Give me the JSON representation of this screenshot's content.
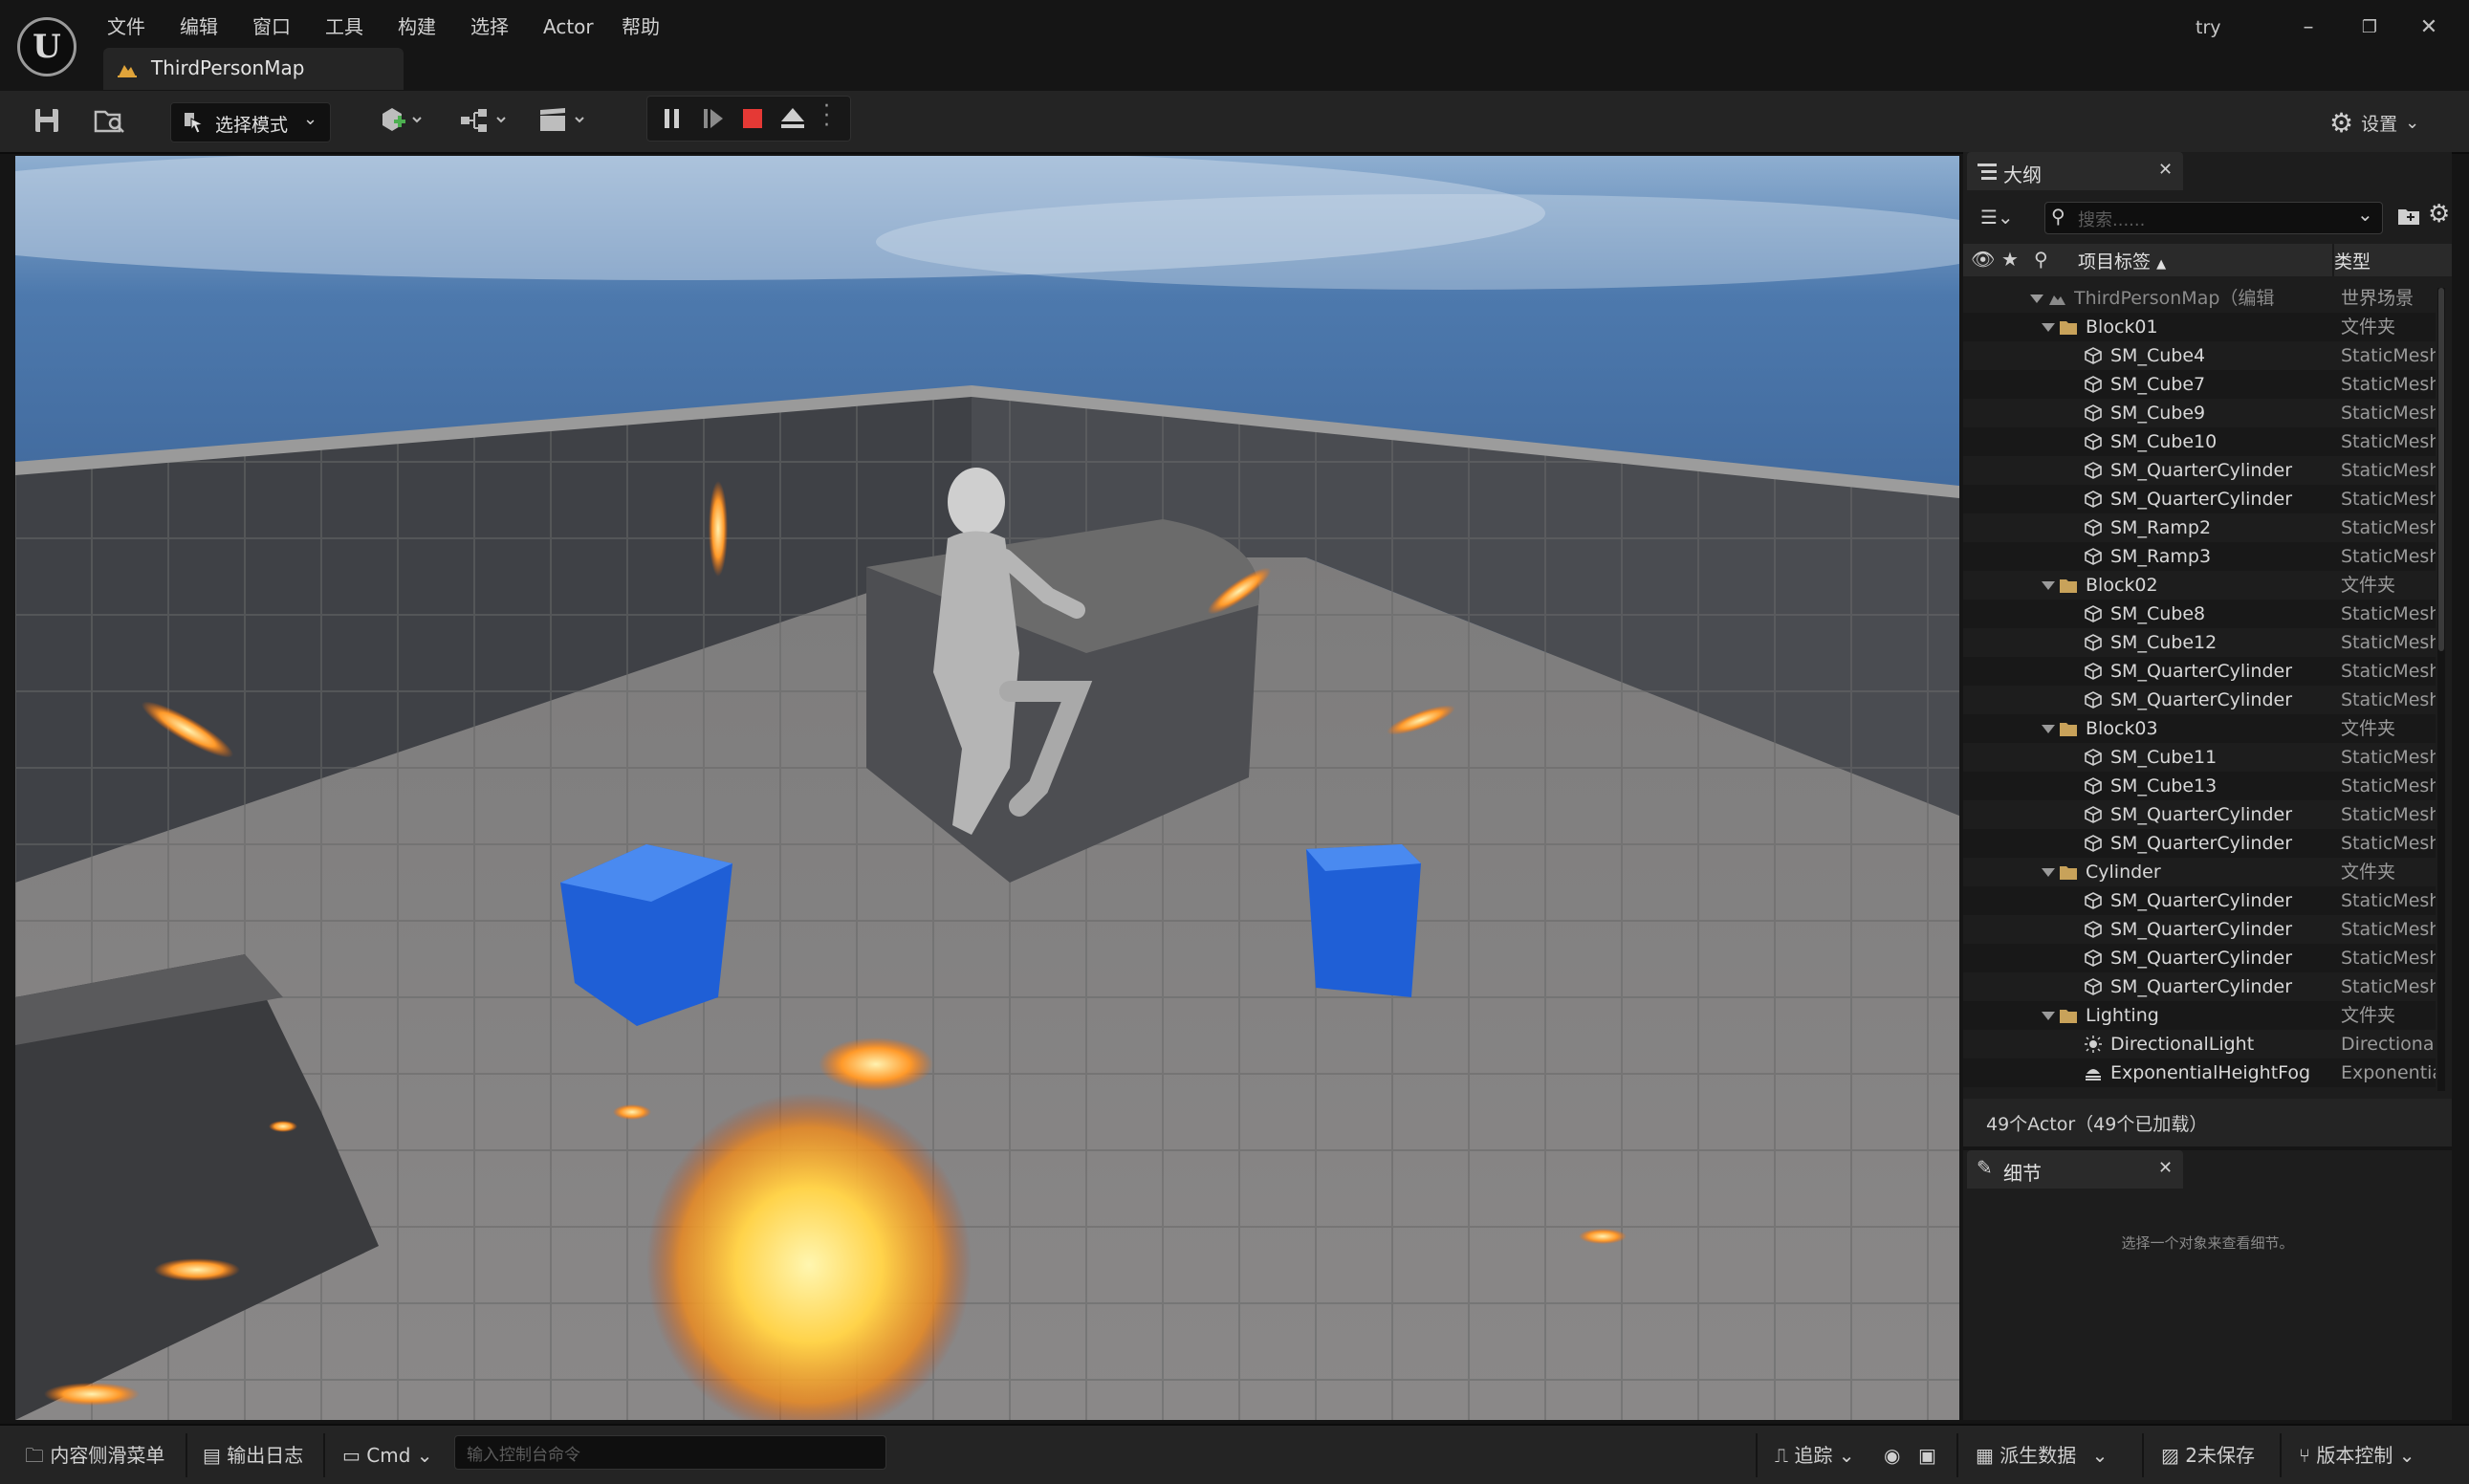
{
  "menu": {
    "items": [
      "文件",
      "编辑",
      "窗口",
      "工具",
      "构建",
      "选择",
      "Actor",
      "帮助"
    ],
    "project_name": "try",
    "logo_text": "U"
  },
  "document_tab": {
    "label": "ThirdPersonMap"
  },
  "toolbar": {
    "mode_label": "选择模式",
    "settings_label": "设置"
  },
  "outliner": {
    "tab_label": "大纲",
    "search_placeholder": "搜索......",
    "col_label": "项目标签",
    "col_type": "类型",
    "rows": [
      {
        "name": "ThirdPersonMap（编辑",
        "type": "世界场景",
        "depth": 0,
        "kind": "map"
      },
      {
        "name": "Block01",
        "type": "文件夹",
        "depth": 1,
        "kind": "folder"
      },
      {
        "name": "SM_Cube4",
        "type": "StaticMesh",
        "depth": 2,
        "kind": "mesh"
      },
      {
        "name": "SM_Cube7",
        "type": "StaticMesh",
        "depth": 2,
        "kind": "mesh"
      },
      {
        "name": "SM_Cube9",
        "type": "StaticMesh",
        "depth": 2,
        "kind": "mesh"
      },
      {
        "name": "SM_Cube10",
        "type": "StaticMesh",
        "depth": 2,
        "kind": "mesh"
      },
      {
        "name": "SM_QuarterCylinder",
        "type": "StaticMesh",
        "depth": 2,
        "kind": "mesh"
      },
      {
        "name": "SM_QuarterCylinder",
        "type": "StaticMesh",
        "depth": 2,
        "kind": "mesh"
      },
      {
        "name": "SM_Ramp2",
        "type": "StaticMesh",
        "depth": 2,
        "kind": "mesh"
      },
      {
        "name": "SM_Ramp3",
        "type": "StaticMesh",
        "depth": 2,
        "kind": "mesh"
      },
      {
        "name": "Block02",
        "type": "文件夹",
        "depth": 1,
        "kind": "folder"
      },
      {
        "name": "SM_Cube8",
        "type": "StaticMesh",
        "depth": 2,
        "kind": "mesh"
      },
      {
        "name": "SM_Cube12",
        "type": "StaticMesh",
        "depth": 2,
        "kind": "mesh"
      },
      {
        "name": "SM_QuarterCylinder",
        "type": "StaticMesh",
        "depth": 2,
        "kind": "mesh"
      },
      {
        "name": "SM_QuarterCylinder",
        "type": "StaticMesh",
        "depth": 2,
        "kind": "mesh"
      },
      {
        "name": "Block03",
        "type": "文件夹",
        "depth": 1,
        "kind": "folder"
      },
      {
        "name": "SM_Cube11",
        "type": "StaticMesh",
        "depth": 2,
        "kind": "mesh"
      },
      {
        "name": "SM_Cube13",
        "type": "StaticMesh",
        "depth": 2,
        "kind": "mesh"
      },
      {
        "name": "SM_QuarterCylinder",
        "type": "StaticMesh",
        "depth": 2,
        "kind": "mesh"
      },
      {
        "name": "SM_QuarterCylinder",
        "type": "StaticMesh",
        "depth": 2,
        "kind": "mesh"
      },
      {
        "name": "Cylinder",
        "type": "文件夹",
        "depth": 1,
        "kind": "folder"
      },
      {
        "name": "SM_QuarterCylinder",
        "type": "StaticMesh",
        "depth": 2,
        "kind": "mesh"
      },
      {
        "name": "SM_QuarterCylinder",
        "type": "StaticMesh",
        "depth": 2,
        "kind": "mesh"
      },
      {
        "name": "SM_QuarterCylinder",
        "type": "StaticMesh",
        "depth": 2,
        "kind": "mesh"
      },
      {
        "name": "SM_QuarterCylinder",
        "type": "StaticMesh",
        "depth": 2,
        "kind": "mesh"
      },
      {
        "name": "Lighting",
        "type": "文件夹",
        "depth": 1,
        "kind": "folder"
      },
      {
        "name": "DirectionalLight",
        "type": "Directional",
        "depth": 2,
        "kind": "light"
      },
      {
        "name": "ExponentialHeightFog",
        "type": "Exponentia",
        "depth": 2,
        "kind": "fog"
      }
    ],
    "footer": "49个Actor（49个已加载）"
  },
  "details": {
    "tab_label": "细节",
    "empty_message": "选择一个对象来查看细节。"
  },
  "statusbar": {
    "content_drawer": "内容侧滑菜单",
    "output_log": "输出日志",
    "cmd_label": "Cmd",
    "console_placeholder": "输入控制台命令",
    "trace_label": "追踪",
    "derived_data": "派生数据",
    "unsaved": "2未保存",
    "source_control": "版本控制"
  },
  "colors": {
    "accent_stop": "#e53935",
    "folder": "#c8a25a",
    "cube_blue": "#1f5fd6"
  }
}
